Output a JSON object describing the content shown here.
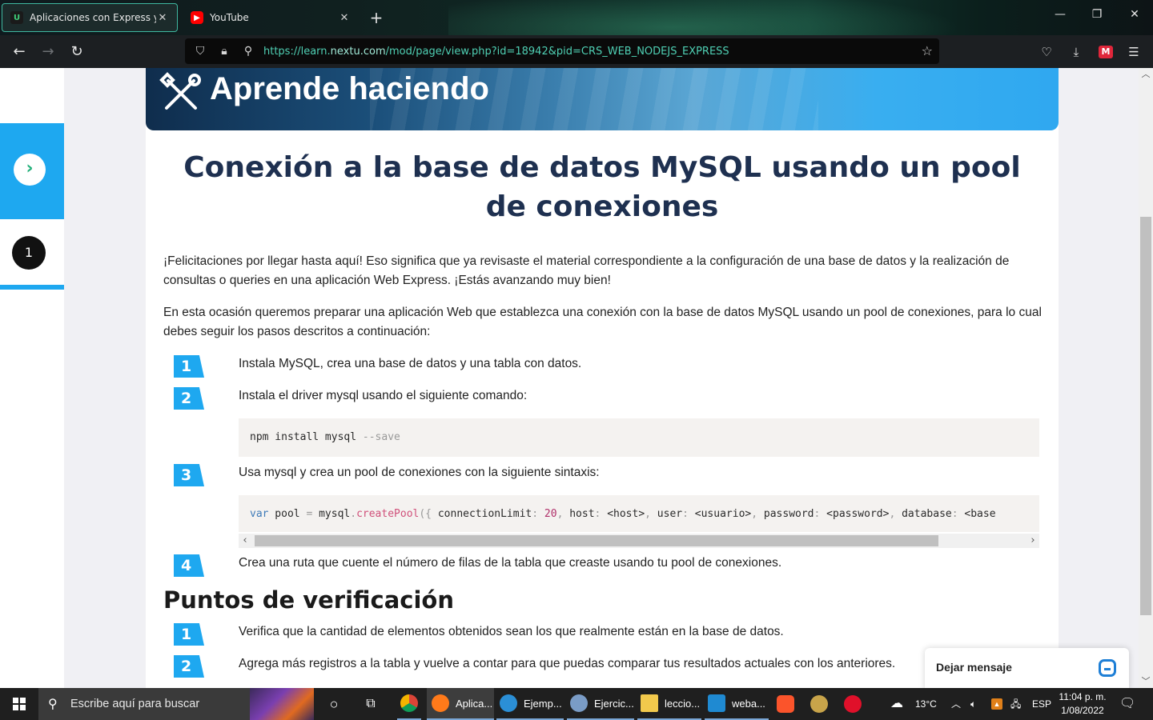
{
  "browser": {
    "tabs": [
      {
        "title": "Aplicaciones con Express y Node",
        "active": true,
        "favicon": "u-logo-icon"
      },
      {
        "title": "YouTube",
        "active": false,
        "favicon": "youtube-icon"
      }
    ],
    "url_prefix": "https://learn.",
    "url_domain": "nextu.com",
    "url_path": "/mod/page/view.php?id=18942&pid=CRS_WEB_NODEJS_EXPRESS"
  },
  "sidebar": {
    "next_icon": "chevron-right-icon",
    "current_step": "1"
  },
  "banner": {
    "title": "Aprende haciendo",
    "icon": "tools-icon"
  },
  "article": {
    "title": "Conexión a la base de datos MySQL usando un pool de conexiones",
    "intro_1": "¡Felicitaciones por llegar hasta aquí! Eso significa que ya revisaste el material correspondiente a la configuración de una base de datos y la realización de consultas o queries en una aplicación Web Express. ¡Estás avanzando muy bien!",
    "intro_2": "En esta ocasión queremos preparar una aplicación Web que establezca una conexión con la base de datos MySQL usando un pool de conexiones, para lo cual debes seguir los pasos descritos a continuación:",
    "steps": [
      {
        "num": "1",
        "text": "Instala MySQL, crea una base de datos y una tabla con datos."
      },
      {
        "num": "2",
        "text": "Instala el driver mysql usando el siguiente comando:"
      },
      {
        "num": "3",
        "text": "Usa mysql y crea un pool de conexiones con la siguiente sintaxis:"
      },
      {
        "num": "4",
        "text": "Crea una ruta que cuente el número de filas de la tabla que creaste usando tu pool de conexiones."
      }
    ],
    "code_1": {
      "cmd": "npm install mysql ",
      "flag": "--save"
    },
    "code_2": {
      "kw": "var",
      "name": " pool ",
      "op": "=",
      "obj": " mysql",
      "dot": ".",
      "fn": "createPool",
      "open": "({",
      "k1": "  connectionLimit",
      "c1": ": ",
      "v1": "20",
      "s1": ",",
      "k2": "  host",
      "c2": ": ",
      "v2": "<host>",
      "s2": ",",
      "k3": "  user",
      "c3": ": ",
      "v3": "<usuario>",
      "s3": ",",
      "k4": "  password",
      "c4": ": ",
      "v4": "<password>",
      "s4": ",",
      "k5": "  database",
      "c5": ": ",
      "v5": "<base"
    },
    "checks_title": "Puntos de verificación",
    "checks": [
      {
        "num": "1",
        "text": "Verifica que la cantidad de elementos obtenidos sean los que realmente están en la base de datos."
      },
      {
        "num": "2",
        "text": "Agrega más registros a la tabla y vuelve a contar para que puedas comparar tus resultados actuales con los anteriores."
      }
    ]
  },
  "chat": {
    "label": "Dejar mensaje"
  },
  "taskbar": {
    "search_placeholder": "Escribe aquí para buscar",
    "apps": [
      {
        "label": "Aplica...",
        "color": "#ff7a1a"
      },
      {
        "label": "Ejemp...",
        "color": "#2b8fd6"
      },
      {
        "label": "Ejercic...",
        "color": "#7a9cc6"
      },
      {
        "label": "leccio...",
        "color": "#f2c94c"
      },
      {
        "label": "weba...",
        "color": "#1f8ad2"
      }
    ],
    "weather": "13°C",
    "lang": "ESP",
    "time": "11:04 p. m.",
    "date": "1/08/2022"
  },
  "colors": {
    "accent": "#1ea8f0",
    "heading": "#1e3050",
    "url": "#4fd0b4"
  }
}
